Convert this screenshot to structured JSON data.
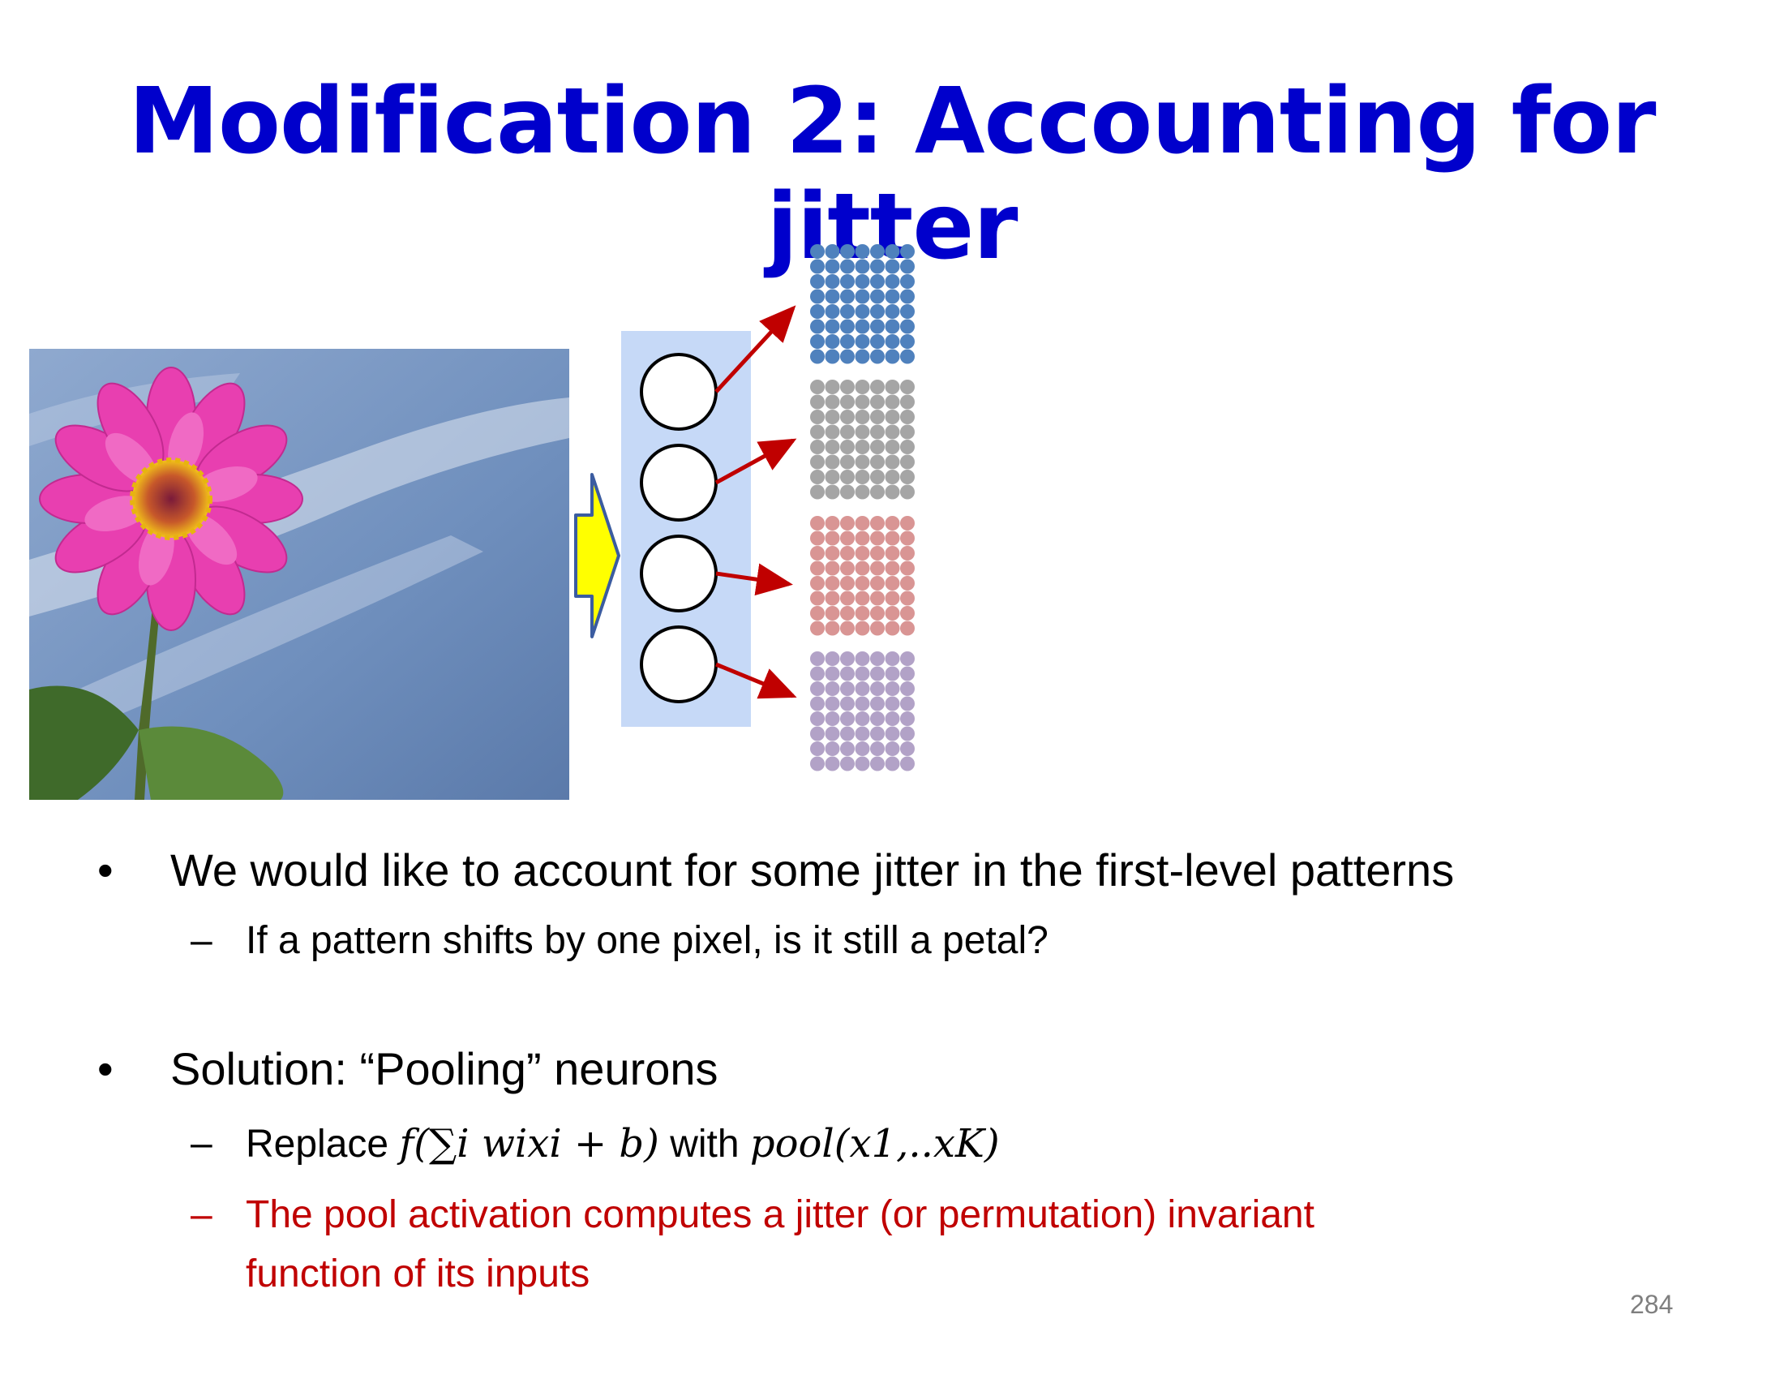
{
  "slide": {
    "title": "Modification 2: Accounting for jitter",
    "page_number": "284"
  },
  "bullets": [
    {
      "text": "We would like to account for some jitter in the first-level patterns",
      "sub": [
        {
          "text": "If a pattern shifts by one pixel, is it still a petal?"
        }
      ]
    },
    {
      "text": "Solution: “Pooling” neurons",
      "sub": [
        {
          "prefix": "Replace ",
          "formula1": "f(∑i wixi +  b)",
          "middle": " with ",
          "formula2": "pool(x1,..xK)"
        },
        {
          "line1": "The pool activation computes a jitter (or permutation) invariant",
          "line2": "function of its inputs"
        }
      ]
    }
  ],
  "markers": {
    "bullet": "•",
    "dash": "–"
  },
  "colors": {
    "title": "#0000cc",
    "red_text": "#c00000",
    "panel": "#c6d9f7",
    "arrow": "#c00000",
    "yellow_arrow": "#ffff00",
    "grid_blue": "#4f81bd",
    "grid_gray": "#a5a5a5",
    "grid_red": "#d99594",
    "grid_purple": "#b2a2c7"
  }
}
